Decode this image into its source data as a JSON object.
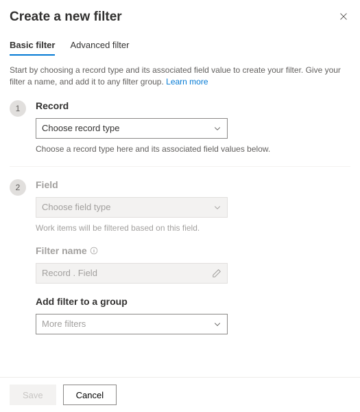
{
  "title": "Create a new filter",
  "tabs": {
    "basic": "Basic filter",
    "advanced": "Advanced filter"
  },
  "intro": {
    "text": "Start by choosing a record type and its associated field value to create your filter. Give your filter a name, and add it to any filter group. ",
    "link": "Learn more"
  },
  "steps": {
    "record": {
      "num": "1",
      "label": "Record",
      "placeholder": "Choose record type",
      "helper": "Choose a record type here and its associated field values below."
    },
    "field": {
      "num": "2",
      "label": "Field",
      "placeholder": "Choose field type",
      "helper": "Work items will be filtered based on this field."
    },
    "filterName": {
      "label": "Filter name",
      "placeholder": "Record . Field"
    },
    "group": {
      "label": "Add filter to a group",
      "value": "More filters"
    }
  },
  "buttons": {
    "save": "Save",
    "cancel": "Cancel"
  }
}
